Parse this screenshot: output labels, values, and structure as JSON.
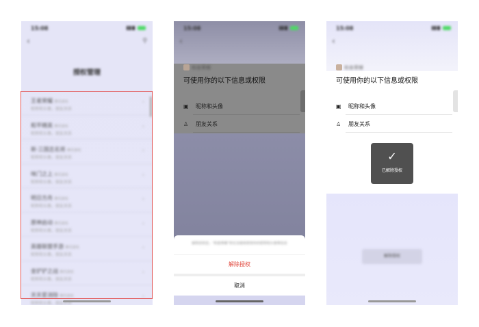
{
  "status": {
    "time": "15:08"
  },
  "screen1": {
    "title": "授权管理",
    "rows": [
      {
        "name": "王者荣耀",
        "tag": "腾讯游戏",
        "sub": "昵称和头像，朋友关系"
      },
      {
        "name": "和平精英",
        "tag": "腾讯游戏",
        "sub": "昵称和头像，朋友关系"
      },
      {
        "name": "新·三国志名将",
        "tag": "腾讯游戏",
        "sub": "昵称和头像，朋友关系"
      },
      {
        "name": "咪门之上",
        "tag": "腾讯游戏",
        "sub": "昵称和头像，朋友关系"
      },
      {
        "name": "明日方舟",
        "tag": "腾讯游戏",
        "sub": "昵称和头像，朋友关系"
      },
      {
        "name": "原神启动",
        "tag": "腾讯游戏",
        "sub": "昵称和头像，朋友关系"
      },
      {
        "name": "英雄联盟手游",
        "tag": "腾讯游戏",
        "sub": "昵称和头像，朋友关系"
      },
      {
        "name": "金铲铲之战",
        "tag": "腾讯游戏",
        "sub": "昵称和头像，朋友关系"
      },
      {
        "name": "天天爱消除",
        "tag": "腾讯游戏",
        "sub": "昵称和头像，朋友关系"
      }
    ]
  },
  "screen2": {
    "app_name": "和金荣耀",
    "heading": "可使用你的以下信息或权限",
    "perm1": "昵称和头像",
    "perm2": "朋友关系",
    "note": "解除授权后，\"和金荣耀\"将无法继续使用你的昵称和头像等信息",
    "revoke": "解除授权",
    "cancel": "取消"
  },
  "screen3": {
    "app_name": "和金荣耀",
    "heading": "可使用你的以下信息或权限",
    "perm1": "昵称和头像",
    "perm2": "朋友关系",
    "toast": "已解除授权",
    "button": "解除授权"
  },
  "colors": {
    "selection": "#e25555",
    "danger": "#e0453a"
  }
}
